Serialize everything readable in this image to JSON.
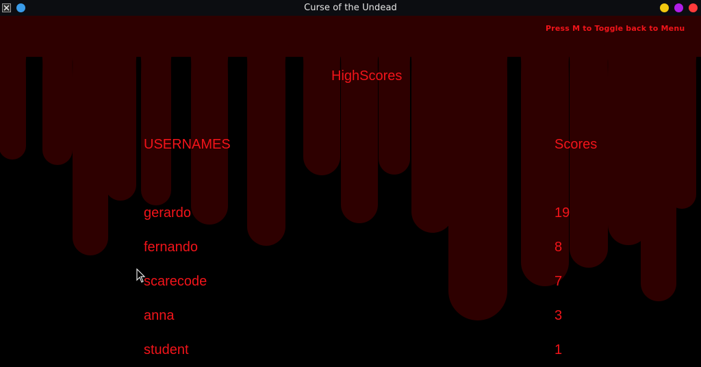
{
  "window": {
    "title": "Curse of the Undead",
    "close_color": "#ff3b3b",
    "maximize_color": "#b01ee8",
    "minimize_color": "#f2c80f",
    "pin_color": "#3a9be8"
  },
  "game": {
    "hint": "Press M to Toggle back to Menu",
    "title": "HighScores",
    "columns": {
      "username": "USERNAMES",
      "score": "Scores"
    },
    "rows": [
      {
        "name": "gerardo",
        "score": "19"
      },
      {
        "name": "fernando",
        "score": "8"
      },
      {
        "name": "scarecode",
        "score": "7"
      },
      {
        "name": "anna",
        "score": "3"
      },
      {
        "name": "student",
        "score": "1"
      }
    ],
    "text_color": "#f2141a",
    "blood_color": "#2e0000",
    "background_color": "#000000"
  }
}
